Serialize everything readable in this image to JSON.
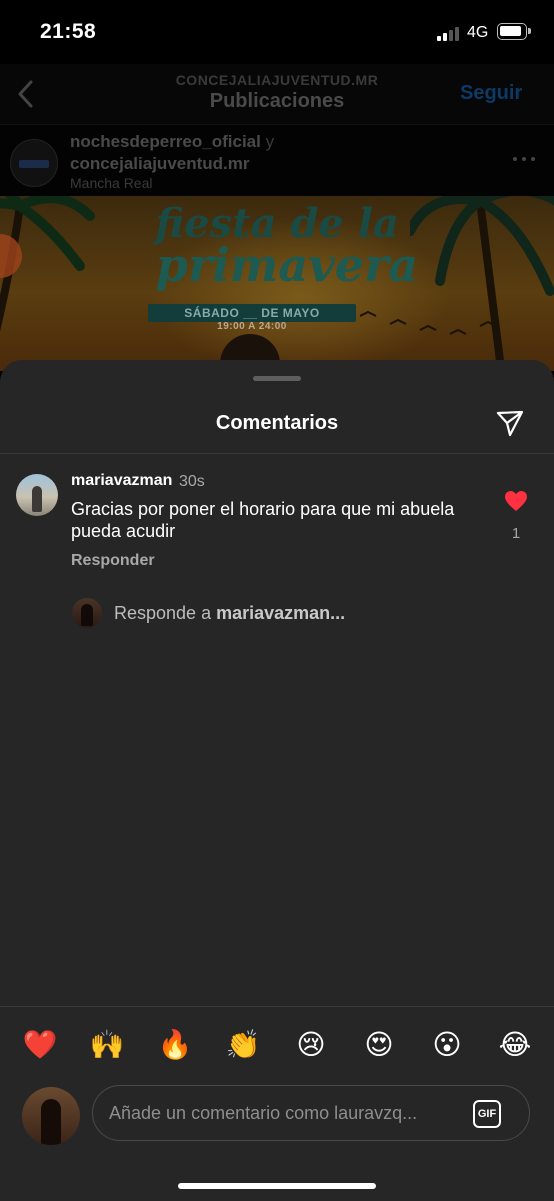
{
  "status_bar": {
    "time": "21:58",
    "network": "4G"
  },
  "nav": {
    "subtitle": "CONCEJALIAJUVENTUD.MR",
    "title": "Publicaciones",
    "follow_label": "Seguir"
  },
  "post": {
    "author_1": "nochesdeperreo_oficial",
    "joiner": "y",
    "author_2": "concejaliajuventud.mr",
    "location": "Mancha Real",
    "poster": {
      "title_line_1": "fiesta de la",
      "title_line_2": "primavera",
      "date_text": "SÁBADO __ DE MAYO",
      "hours_text": "19:00 A 24:00"
    }
  },
  "comments_sheet": {
    "title": "Comentarios",
    "comments": [
      {
        "username": "mariavazman",
        "time": "30s",
        "text": "Gracias por poner el horario para que mi abuela pueda acudir",
        "reply_label": "Responder",
        "likes": "1",
        "liked": true
      }
    ],
    "reply_prompt_prefix": "Responde a",
    "reply_prompt_user": "mariavazman..."
  },
  "composer": {
    "emojis": [
      "❤️",
      "🙌",
      "🔥",
      "👏",
      "😢",
      "😍",
      "😮",
      "😂"
    ],
    "placeholder": "Añade un comentario como lauravzq...",
    "gif_label": "GIF"
  },
  "colors": {
    "like_red": "#ff3040",
    "sheet_bg": "#262626",
    "follow_blue": "#0b3a66"
  }
}
